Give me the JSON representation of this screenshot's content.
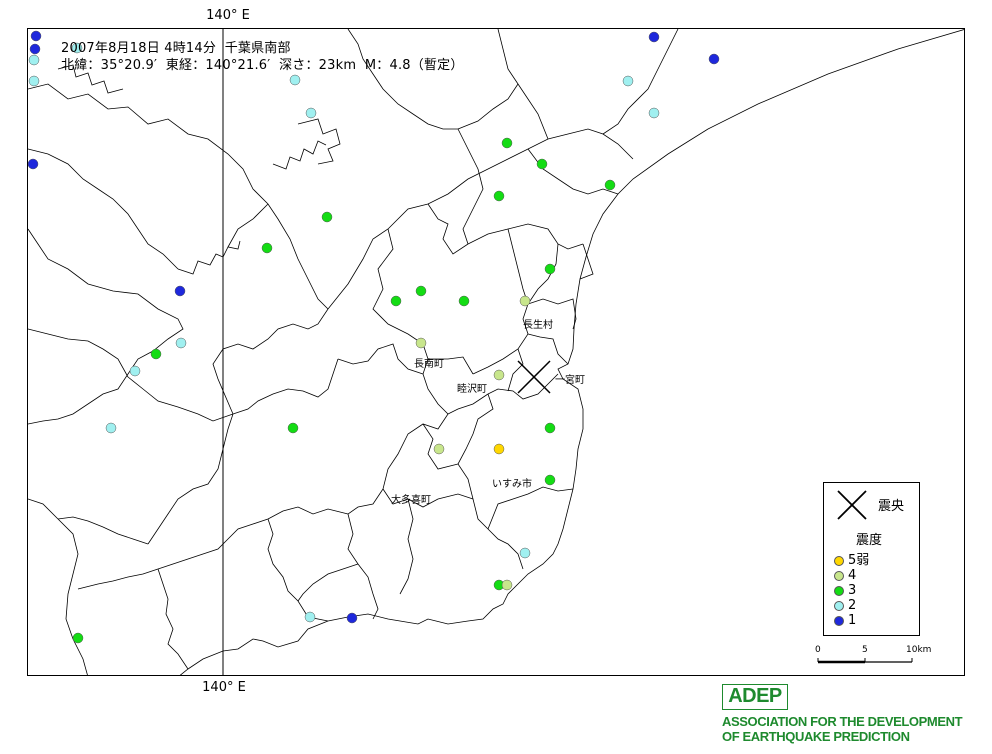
{
  "header": {
    "line1": "2007年8月18日 4時14分  千葉県南部",
    "line2": "北緯：35°20.9′  東経：140°21.6′  深さ：23km  M：4.8（暫定）"
  },
  "meridian_label": "140° E",
  "towns": [
    {
      "id": "chonan",
      "label": "長南町"
    },
    {
      "id": "chosei",
      "label": "長生村"
    },
    {
      "id": "mutsuzawa",
      "label": "睦沢町"
    },
    {
      "id": "ichinomiya",
      "label": "一宮町"
    },
    {
      "id": "isumi",
      "label": "いすみ市"
    },
    {
      "id": "otaki",
      "label": "大多喜町"
    }
  ],
  "legend": {
    "epicenter_label": "震央",
    "intensity_title": "震度",
    "items": [
      {
        "label": "5弱",
        "color": "#ffd700"
      },
      {
        "label": "4",
        "color": "#c8e68c"
      },
      {
        "label": "3",
        "color": "#14dc14"
      },
      {
        "label": "2",
        "color": "#a0f0f0"
      },
      {
        "label": "1",
        "color": "#1e28dc"
      }
    ]
  },
  "scale": {
    "labels": [
      "0",
      "5",
      "10km"
    ]
  },
  "branding": {
    "logo": "ADEP",
    "line1": "ASSOCIATION FOR THE DEVELOPMENT",
    "line2": "OF EARTHQUAKE PREDICTION",
    "color": "#1e8a2e"
  },
  "stations": [
    {
      "i": "1"
    },
    {
      "i": "1"
    },
    {
      "i": "1"
    },
    {
      "i": "1"
    },
    {
      "i": "1"
    },
    {
      "i": "1"
    },
    {
      "i": "1"
    },
    {
      "i": "2"
    },
    {
      "i": "2"
    },
    {
      "i": "2"
    },
    {
      "i": "2"
    },
    {
      "i": "2"
    },
    {
      "i": "2"
    },
    {
      "i": "2"
    },
    {
      "i": "2"
    },
    {
      "i": "2"
    },
    {
      "i": "2"
    },
    {
      "i": "2"
    },
    {
      "i": "2"
    },
    {
      "i": "3"
    },
    {
      "i": "3"
    },
    {
      "i": "3"
    },
    {
      "i": "3"
    },
    {
      "i": "3"
    },
    {
      "i": "3"
    },
    {
      "i": "3"
    },
    {
      "i": "3"
    },
    {
      "i": "3"
    },
    {
      "i": "3"
    },
    {
      "i": "3"
    },
    {
      "i": "3"
    },
    {
      "i": "3"
    },
    {
      "i": "3"
    },
    {
      "i": "3"
    },
    {
      "i": "3"
    },
    {
      "i": "4"
    },
    {
      "i": "4"
    },
    {
      "i": "4"
    },
    {
      "i": "4"
    },
    {
      "i": "4"
    },
    {
      "i": "5弱"
    }
  ]
}
